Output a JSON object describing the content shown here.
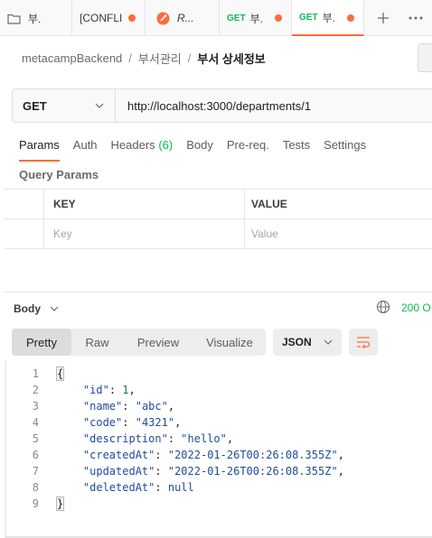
{
  "tabs": [
    {
      "label": "부.",
      "has_icon": "folder-icon",
      "dirty": false
    },
    {
      "label": "[CONFLI",
      "dirty": true
    },
    {
      "label": "R...",
      "has_icon": "postman-icon",
      "dirty": false
    },
    {
      "method": "GET",
      "label": "부.",
      "dirty": true
    },
    {
      "method": "GET",
      "label": "부.",
      "dirty": true,
      "active": true
    }
  ],
  "breadcrumb": {
    "collection": "metacampBackend",
    "folder": "부서관리",
    "request": "부서 상세정보"
  },
  "request": {
    "method": "GET",
    "url": "http://localhost:3000/departments/1"
  },
  "request_tabs": {
    "params": "Params",
    "auth": "Auth",
    "headers": "Headers",
    "headers_count": "(6)",
    "body": "Body",
    "prereq": "Pre-req.",
    "tests": "Tests",
    "settings": "Settings"
  },
  "params": {
    "title": "Query Params",
    "col_key": "KEY",
    "col_value": "VALUE",
    "key_placeholder": "Key",
    "value_placeholder": "Value"
  },
  "response": {
    "body_label": "Body",
    "status": "200 O",
    "views": [
      "Pretty",
      "Raw",
      "Preview",
      "Visualize"
    ],
    "active_view": "Pretty",
    "format": "JSON",
    "lines": [
      "1",
      "2",
      "3",
      "4",
      "5",
      "6",
      "7",
      "8",
      "9"
    ],
    "json": {
      "open": "{",
      "close": "}",
      "id_key": "\"id\"",
      "id_val": "1",
      "name_key": "\"name\"",
      "name_val": "\"abc\"",
      "code_key": "\"code\"",
      "code_val": "\"4321\"",
      "desc_key": "\"description\"",
      "desc_val": "\"hello\"",
      "created_key": "\"createdAt\"",
      "created_val": "\"2022-01-26T00:26:08.355Z\"",
      "updated_key": "\"updatedAt\"",
      "updated_val": "\"2022-01-26T00:26:08.355Z\"",
      "deleted_key": "\"deletedAt\"",
      "deleted_val": "null"
    }
  },
  "colors": {
    "accent": "#ff6c37",
    "get_method": "#0cbb52",
    "status_ok": "#0cbb52"
  }
}
